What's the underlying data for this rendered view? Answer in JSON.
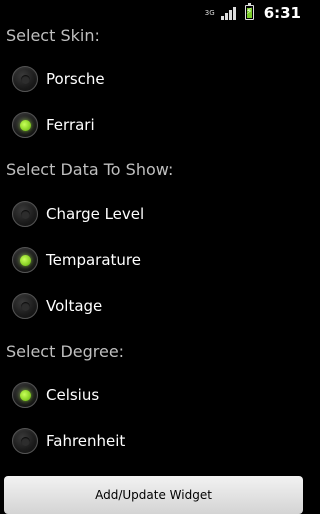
{
  "status_bar": {
    "network": "3G",
    "time": "6:31",
    "icons": [
      "3g-icon",
      "signal-icon",
      "battery-charging-icon"
    ]
  },
  "sections": [
    {
      "title": "Select Skin:",
      "options": [
        {
          "label": "Porsche",
          "checked": false
        },
        {
          "label": "Ferrari",
          "checked": true
        }
      ]
    },
    {
      "title": "Select Data To Show:",
      "options": [
        {
          "label": "Charge Level",
          "checked": false
        },
        {
          "label": "Temparature",
          "checked": true
        },
        {
          "label": "Voltage",
          "checked": false
        }
      ]
    },
    {
      "title": "Select Degree:",
      "options": [
        {
          "label": "Celsius",
          "checked": true
        },
        {
          "label": "Fahrenheit",
          "checked": false
        }
      ]
    }
  ],
  "action_button": {
    "label": "Add/Update Widget"
  },
  "colors": {
    "background": "#000000",
    "header_text": "#bfbfbf",
    "radio_checked": "#8fd62a",
    "button_bg": "#e0e0e0"
  }
}
